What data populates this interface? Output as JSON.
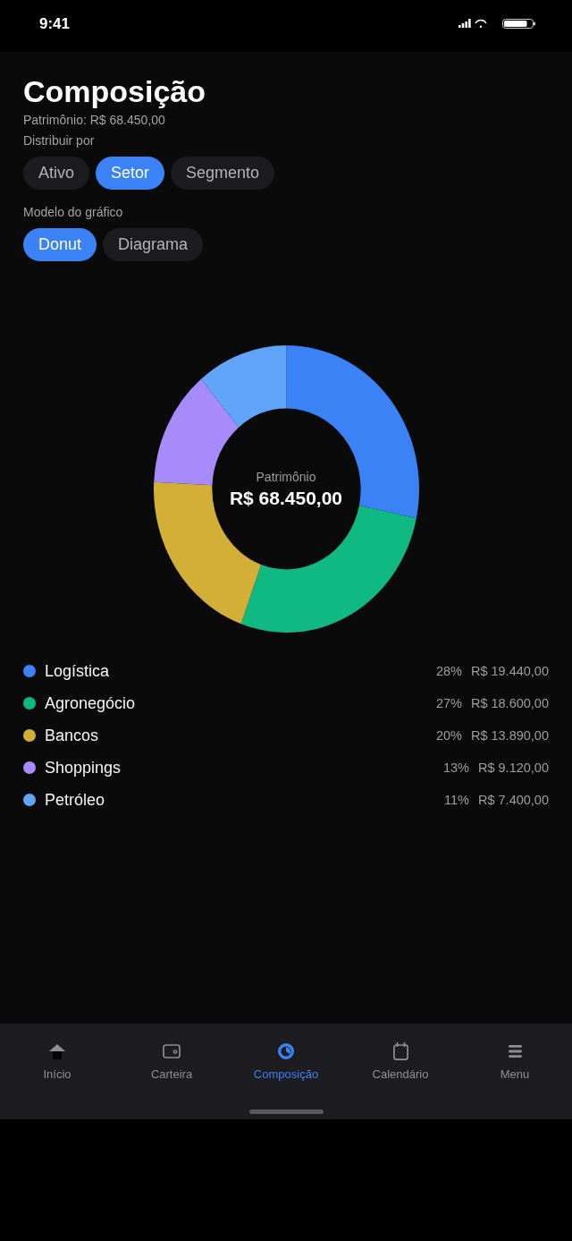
{
  "status_bar": {
    "time": "9:41"
  },
  "header": {
    "title": "Composição",
    "subtitle": "Patrimônio: R$ 68.450,00"
  },
  "distribute_by": {
    "label": "Distribuir por",
    "options": [
      {
        "label": "Ativo",
        "selected": false
      },
      {
        "label": "Setor",
        "selected": true
      },
      {
        "label": "Segmento",
        "selected": false
      }
    ]
  },
  "chart_model": {
    "label": "Modelo do gráfico",
    "options": [
      {
        "label": "Donut",
        "selected": true
      },
      {
        "label": "Diagrama",
        "selected": false
      }
    ]
  },
  "composition": {
    "center_label": "Patrimônio",
    "center_value": "R$ 68.450,00",
    "chart_data": {
      "type": "donut",
      "categories": [
        "Logística",
        "Agronegócio",
        "Bancos",
        "Shoppings",
        "Petróleo"
      ],
      "values": [
        28,
        27,
        20,
        13,
        11
      ],
      "legend": "bottom"
    },
    "legend": [
      {
        "color": "#3b82f6",
        "percent": "28%",
        "amount": "R$ 19.440,00"
      },
      {
        "color": "#10b981",
        "percent": "27%",
        "amount": "R$ 18.600,00"
      },
      {
        "color": "#d4af37",
        "percent": "20%",
        "amount": "R$ 13.890,00"
      },
      {
        "color": "#a78bfa",
        "percent": "13%",
        "amount": "R$ 9.120,00"
      },
      {
        "color": "#60a5fa",
        "percent": "11%",
        "amount": "R$ 7.400,00"
      }
    ]
  },
  "tab_bar": {
    "items": [
      {
        "label": "Início",
        "selected": false
      },
      {
        "label": "Carteira",
        "selected": false
      },
      {
        "label": "Composição",
        "selected": true
      },
      {
        "label": "Calendário",
        "selected": false
      },
      {
        "label": "Menu",
        "selected": false
      }
    ]
  }
}
